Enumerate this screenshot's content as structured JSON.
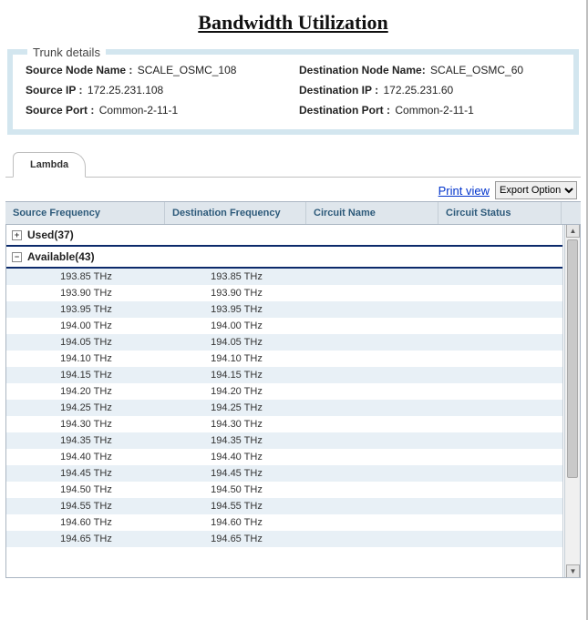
{
  "title": "Bandwidth Utilization",
  "trunk_legend": "Trunk details",
  "trunk": {
    "src_node_label": "Source Node Name :",
    "src_node_value": "SCALE_OSMC_108",
    "dst_node_label": "Destination Node Name:",
    "dst_node_value": "SCALE_OSMC_60",
    "src_ip_label": "Source IP :",
    "src_ip_value": "172.25.231.108",
    "dst_ip_label": "Destination IP :",
    "dst_ip_value": "172.25.231.60",
    "src_port_label": "Source Port :",
    "src_port_value": "Common-2-11-1",
    "dst_port_label": "Destination Port :",
    "dst_port_value": "Common-2-11-1"
  },
  "tab": {
    "lambda": "Lambda"
  },
  "toolbar": {
    "print_view": "Print view",
    "export_option": "Export Option"
  },
  "columns": {
    "source_freq": "Source Frequency",
    "dest_freq": "Destination Frequency",
    "circuit_name": "Circuit Name",
    "circuit_status": "Circuit Status"
  },
  "groups": {
    "used": {
      "label": "Used(37)",
      "expander": "+"
    },
    "available": {
      "label": "Available(43)",
      "expander": "−"
    }
  },
  "available_rows": [
    {
      "src": "193.85 THz",
      "dst": "193.85 THz",
      "name": "",
      "status": ""
    },
    {
      "src": "193.90 THz",
      "dst": "193.90 THz",
      "name": "",
      "status": ""
    },
    {
      "src": "193.95 THz",
      "dst": "193.95 THz",
      "name": "",
      "status": ""
    },
    {
      "src": "194.00 THz",
      "dst": "194.00 THz",
      "name": "",
      "status": ""
    },
    {
      "src": "194.05 THz",
      "dst": "194.05 THz",
      "name": "",
      "status": ""
    },
    {
      "src": "194.10 THz",
      "dst": "194.10 THz",
      "name": "",
      "status": ""
    },
    {
      "src": "194.15 THz",
      "dst": "194.15 THz",
      "name": "",
      "status": ""
    },
    {
      "src": "194.20 THz",
      "dst": "194.20 THz",
      "name": "",
      "status": ""
    },
    {
      "src": "194.25 THz",
      "dst": "194.25 THz",
      "name": "",
      "status": ""
    },
    {
      "src": "194.30 THz",
      "dst": "194.30 THz",
      "name": "",
      "status": ""
    },
    {
      "src": "194.35 THz",
      "dst": "194.35 THz",
      "name": "",
      "status": ""
    },
    {
      "src": "194.40 THz",
      "dst": "194.40 THz",
      "name": "",
      "status": ""
    },
    {
      "src": "194.45 THz",
      "dst": "194.45 THz",
      "name": "",
      "status": ""
    },
    {
      "src": "194.50 THz",
      "dst": "194.50 THz",
      "name": "",
      "status": ""
    },
    {
      "src": "194.55 THz",
      "dst": "194.55 THz",
      "name": "",
      "status": ""
    },
    {
      "src": "194.60 THz",
      "dst": "194.60 THz",
      "name": "",
      "status": ""
    },
    {
      "src": "194.65 THz",
      "dst": "194.65 THz",
      "name": "",
      "status": ""
    }
  ]
}
